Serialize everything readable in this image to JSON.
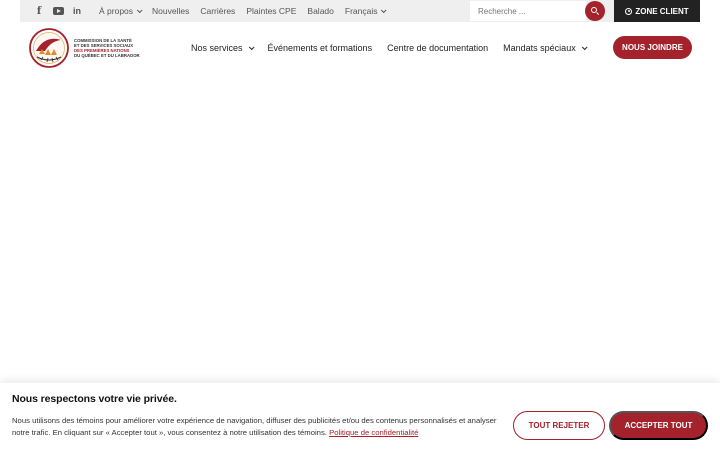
{
  "topbar": {
    "social": [
      {
        "icon": "facebook-icon",
        "glyph": "f"
      },
      {
        "icon": "youtube-icon"
      },
      {
        "icon": "linkedin-icon",
        "glyph": "in"
      }
    ],
    "links": [
      {
        "label": "À propos",
        "dropdown": true
      },
      {
        "label": "Nouvelles",
        "dropdown": false
      },
      {
        "label": "Carrières",
        "dropdown": false
      },
      {
        "label": "Plaintes CPE",
        "dropdown": false
      },
      {
        "label": "Balado",
        "dropdown": false
      },
      {
        "label": "Français",
        "dropdown": true
      }
    ],
    "search_placeholder": "Recherche ...",
    "zone_client_label": "ZONE CLIENT"
  },
  "logo": {
    "line1": "COMMISSION DE LA SANTÉ",
    "line2": "ET DES SERVICES SOCIAUX",
    "line3": "DES PREMIÈRES NATIONS",
    "line4": "DU QUÉBEC ET DU LABRADOR"
  },
  "mainnav": {
    "items": [
      {
        "label": "Nos services",
        "dropdown": true
      },
      {
        "label": "Événements et formations",
        "dropdown": false
      },
      {
        "label": "Centre de documentation",
        "dropdown": false
      },
      {
        "label": "Mandats spéciaux",
        "dropdown": true
      }
    ],
    "join_label": "NOUS JOINDRE"
  },
  "cookie": {
    "title": "Nous respectons votre vie privée.",
    "text": "Nous utilisons des témoins pour améliorer votre expérience de navigation, diffuser des publicités et/ou des contenus personnalisés et analyser notre trafic. En cliquant sur « Accepter tout », vous consentez à notre utilisation des témoins.",
    "policy_link": "Politique de confidentialité",
    "reject_label": "TOUT REJETER",
    "accept_label": "ACCEPTER TOUT"
  },
  "colors": {
    "accent": "#a3222b",
    "topbar_bg": "#efefef",
    "zone_bg": "#222222"
  }
}
